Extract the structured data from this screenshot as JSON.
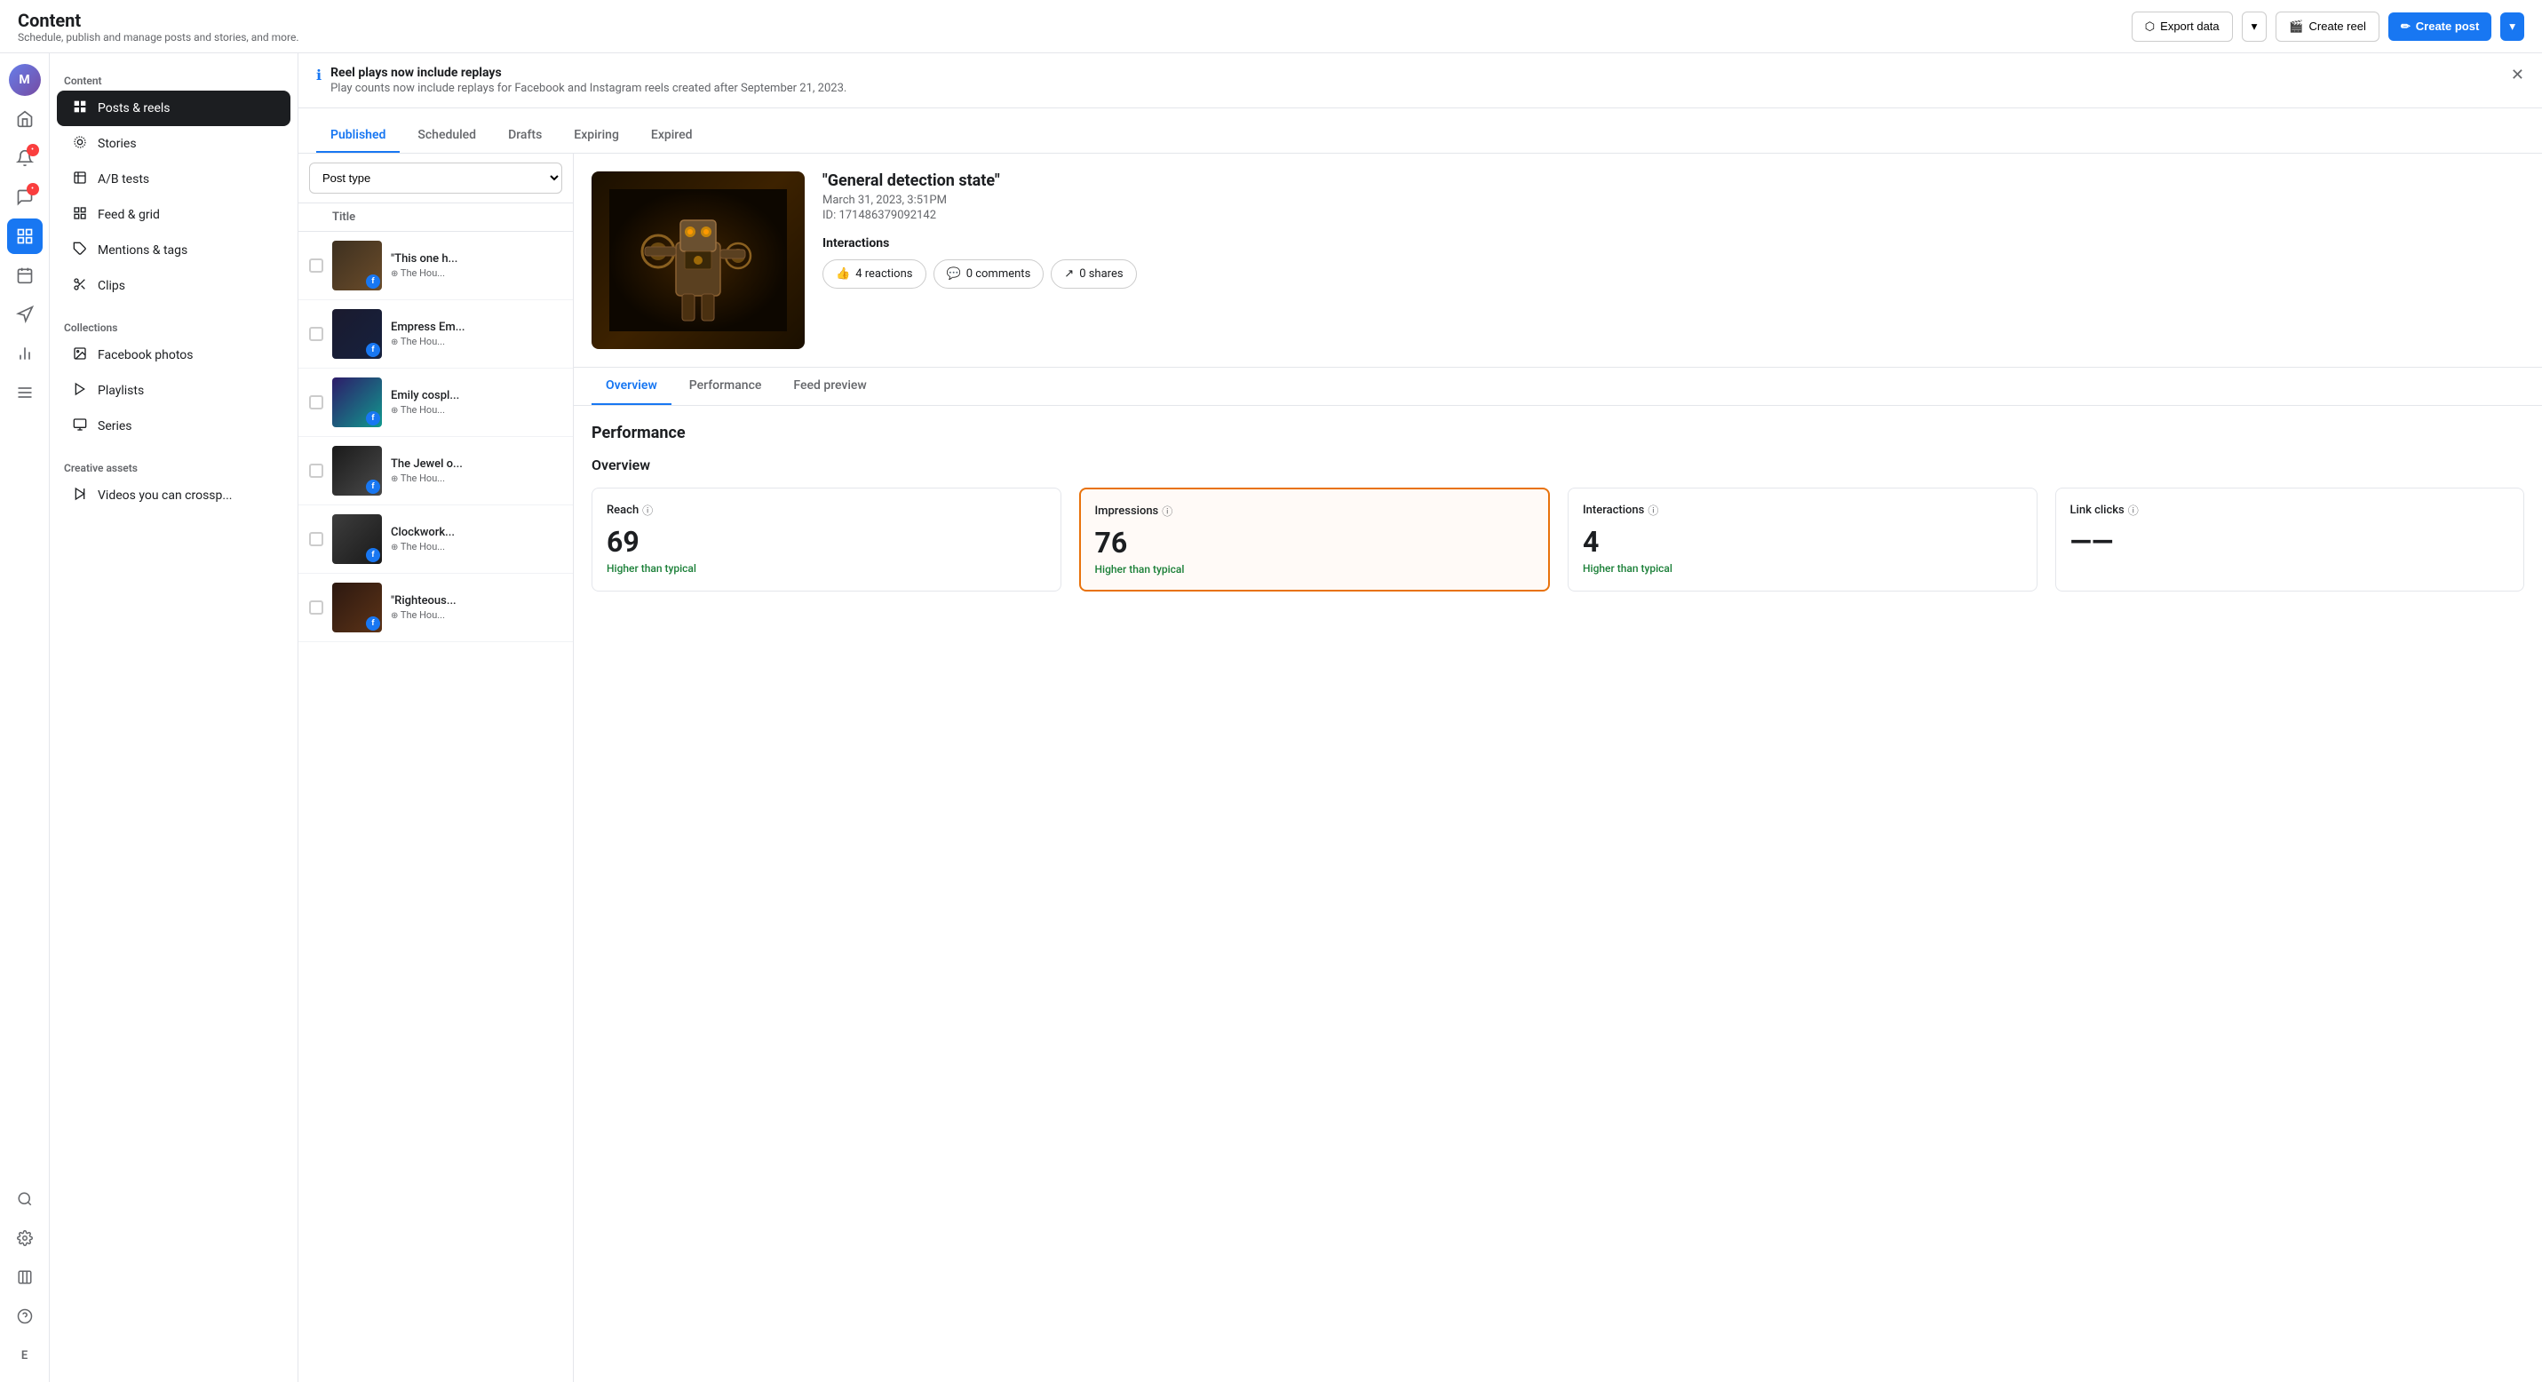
{
  "app": {
    "title": "Content",
    "subtitle": "Schedule, publish and manage posts and stories, and more."
  },
  "header": {
    "export_label": "Export data",
    "create_reel_label": "Create reel",
    "create_post_label": "Create post"
  },
  "banner": {
    "title": "Reel plays now include replays",
    "description": "Play counts now include replays for Facebook and Instagram reels created after September 21, 2023."
  },
  "sidebar": {
    "content_label": "Content",
    "items": [
      {
        "id": "posts-reels",
        "label": "Posts & reels",
        "icon": "▦",
        "active": true
      },
      {
        "id": "stories",
        "label": "Stories",
        "icon": "◎",
        "active": false
      },
      {
        "id": "ab-tests",
        "label": "A/B tests",
        "icon": "⚗",
        "active": false
      },
      {
        "id": "feed-grid",
        "label": "Feed & grid",
        "icon": "⊞",
        "active": false
      },
      {
        "id": "mentions-tags",
        "label": "Mentions & tags",
        "icon": "🏷",
        "active": false
      },
      {
        "id": "clips",
        "label": "Clips",
        "icon": "✂",
        "active": false
      }
    ],
    "collections_label": "Collections",
    "collections": [
      {
        "id": "facebook-photos",
        "label": "Facebook photos",
        "icon": "🖼"
      },
      {
        "id": "playlists",
        "label": "Playlists",
        "icon": "▶"
      },
      {
        "id": "series",
        "label": "Series",
        "icon": "📺"
      }
    ],
    "creative_label": "Creative assets",
    "creative": [
      {
        "id": "videos-crosspost",
        "label": "Videos you can crossp...",
        "icon": "▷"
      }
    ]
  },
  "tabs": [
    {
      "id": "published",
      "label": "Published",
      "active": true
    },
    {
      "id": "scheduled",
      "label": "Scheduled",
      "active": false
    },
    {
      "id": "drafts",
      "label": "Drafts",
      "active": false
    },
    {
      "id": "expiring",
      "label": "Expiring",
      "active": false
    },
    {
      "id": "expired",
      "label": "Expired",
      "active": false
    }
  ],
  "list": {
    "filter_label": "Post type",
    "col_title": "Title",
    "items": [
      {
        "id": 1,
        "title": "\"This one h...",
        "meta": "The Hou...",
        "thumb_class": "thumb-1"
      },
      {
        "id": 2,
        "title": "Empress Em...",
        "meta": "The Hou...",
        "thumb_class": "thumb-2"
      },
      {
        "id": 3,
        "title": "Emily cospl...",
        "meta": "The Hou...",
        "thumb_class": "thumb-3"
      },
      {
        "id": 4,
        "title": "The Jewel o...",
        "meta": "The Hou...",
        "thumb_class": "thumb-4"
      },
      {
        "id": 5,
        "title": "Clockwork...",
        "meta": "The Hou...",
        "thumb_class": "thumb-5"
      },
      {
        "id": 6,
        "title": "\"Righteous...",
        "meta": "The Hou...",
        "thumb_class": "thumb-6"
      }
    ]
  },
  "detail": {
    "title": "\"General detection state\"",
    "date": "March 31, 2023, 3:51PM",
    "id_label": "ID: 171486379092142",
    "interactions_label": "Interactions",
    "reactions_label": "4 reactions",
    "comments_label": "0 comments",
    "shares_label": "0 shares",
    "tabs": [
      {
        "id": "overview",
        "label": "Overview",
        "active": true
      },
      {
        "id": "performance",
        "label": "Performance",
        "active": false
      },
      {
        "id": "feed-preview",
        "label": "Feed preview",
        "active": false
      }
    ],
    "performance_title": "Performance",
    "overview_label": "Overview",
    "metrics": [
      {
        "id": "reach",
        "label": "Reach",
        "value": "69",
        "status": "Higher than typical",
        "status_type": "positive",
        "highlighted": false
      },
      {
        "id": "impressions",
        "label": "Impressions",
        "value": "76",
        "status": "Higher than typical",
        "status_type": "positive",
        "highlighted": true
      },
      {
        "id": "interactions",
        "label": "Interactions",
        "value": "4",
        "status": "Higher than typical",
        "status_type": "positive",
        "highlighted": false
      },
      {
        "id": "link-clicks",
        "label": "Link clicks",
        "value": "——",
        "status": "",
        "status_type": "neutral",
        "highlighted": false
      }
    ]
  },
  "icon_sidebar": {
    "items": [
      {
        "id": "avatar",
        "icon": "M",
        "type": "avatar"
      },
      {
        "id": "home",
        "icon": "⌂",
        "badge": false
      },
      {
        "id": "notifications",
        "icon": "🔔",
        "badge": true
      },
      {
        "id": "messages",
        "icon": "💬",
        "badge": true
      },
      {
        "id": "content",
        "icon": "▦",
        "active": true
      },
      {
        "id": "calendar",
        "icon": "⊞",
        "badge": false
      },
      {
        "id": "megaphone",
        "icon": "📢",
        "badge": false
      },
      {
        "id": "chart",
        "icon": "📊",
        "badge": false
      },
      {
        "id": "menu",
        "icon": "☰",
        "badge": false
      }
    ],
    "bottom": [
      {
        "id": "search",
        "icon": "🔍"
      },
      {
        "id": "settings",
        "icon": "⚙"
      },
      {
        "id": "expand",
        "icon": "⊡"
      },
      {
        "id": "help",
        "icon": "?"
      },
      {
        "id": "letter",
        "label": "E"
      }
    ]
  }
}
